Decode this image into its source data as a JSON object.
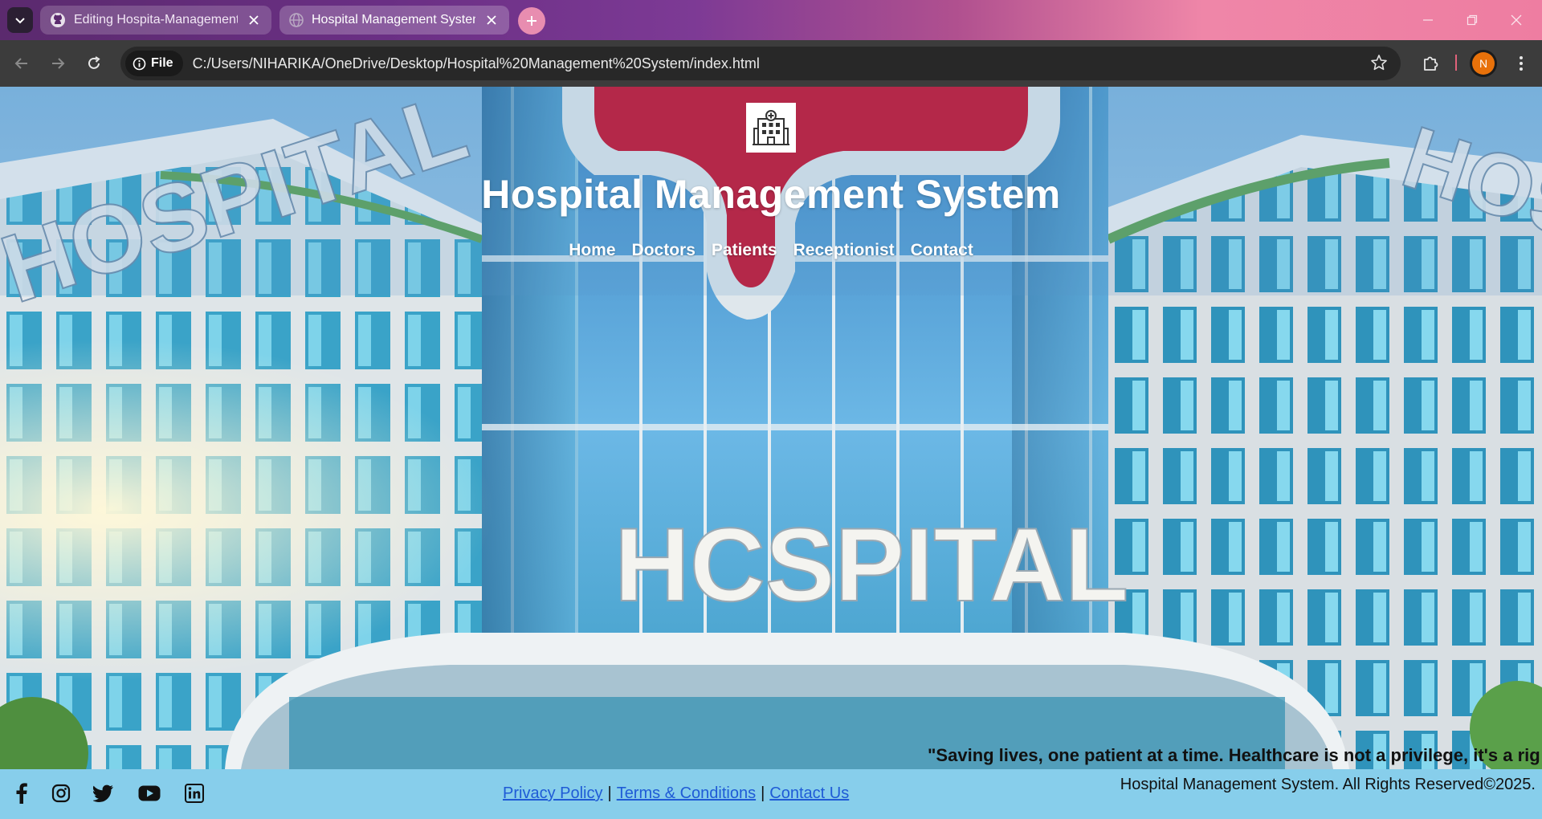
{
  "browser": {
    "tabs": [
      {
        "title": "Editing Hospita-Management-S",
        "active": false,
        "icon": "github-icon"
      },
      {
        "title": "Hospital Management System",
        "active": true,
        "icon": "globe-icon"
      }
    ],
    "address": {
      "scheme_label": "File",
      "url": "C:/Users/NIHARIKA/OneDrive/Desktop/Hospital%20Management%20System/index.html"
    },
    "profile_initial": "N",
    "accent_color": "#e8710a"
  },
  "page": {
    "logo_icon": "hospital-building-icon",
    "title": "Hospital Management System",
    "nav": [
      "Home",
      "Doctors",
      "Patients",
      "Receptionist",
      "Contact"
    ],
    "marquee": "\"Saving lives, one patient at a time. Healthcare is not a privilege, it's a rig",
    "footer": {
      "social": [
        "facebook-icon",
        "instagram-icon",
        "twitter-icon",
        "youtube-icon",
        "linkedin-icon"
      ],
      "links": [
        "Privacy Policy",
        "Terms & Conditions",
        "Contact Us"
      ],
      "separator": "|",
      "copyright": "Hospital Management System. All Rights Reserved©2025."
    },
    "footer_color": "#87ceeb",
    "link_color": "#1f5bd6"
  }
}
